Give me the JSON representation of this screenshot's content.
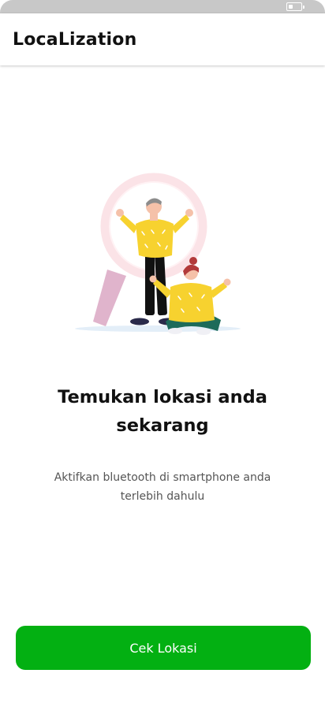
{
  "status_bar": {
    "battery_icon": "battery-icon",
    "battery_level": 0.4
  },
  "app_bar": {
    "title": "LocaLization"
  },
  "illustration": {
    "icon": "people-magnifier-illustration"
  },
  "main": {
    "headline": "Temukan lokasi anda sekarang",
    "subtext": "Aktifkan bluetooth di smartphone anda terlebih dahulu"
  },
  "cta": {
    "label": "Cek Lokasi",
    "color": "#03b012"
  }
}
